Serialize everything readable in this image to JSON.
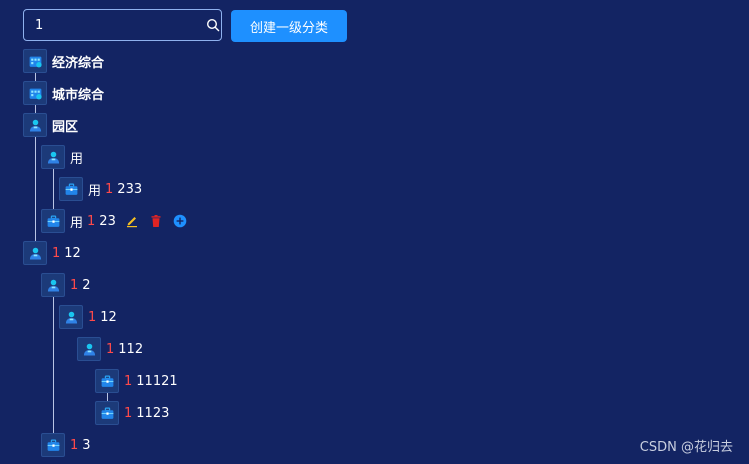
{
  "search": {
    "value": "1",
    "icon": "search-icon"
  },
  "toolbar": {
    "create_label": "创建一级分类"
  },
  "colors": {
    "background": "#132463",
    "highlight": "#ff4a4a",
    "primary": "#1e90ff",
    "edit": "#f5c022",
    "delete": "#e02424"
  },
  "tree": [
    {
      "id": "n0",
      "match": "",
      "rest": "经济综合",
      "icon": "department-icon",
      "depth": 0,
      "bold": true
    },
    {
      "id": "n1",
      "match": "",
      "rest": "城市综合",
      "icon": "department-icon",
      "depth": 0,
      "bold": true
    },
    {
      "id": "n2",
      "match": "",
      "rest": "园区",
      "icon": "person-icon",
      "depth": 0,
      "bold": true
    },
    {
      "id": "n3",
      "match": "",
      "rest": "用",
      "icon": "person-icon",
      "depth": 1
    },
    {
      "id": "n4",
      "pre": "用",
      "match": "1",
      "rest": "233",
      "icon": "briefcase-icon",
      "depth": 2
    },
    {
      "id": "n5",
      "pre": "用",
      "match": "1",
      "rest": "23",
      "icon": "briefcase-icon",
      "depth": 1,
      "actions": true
    },
    {
      "id": "n6",
      "match": "1",
      "rest": "12",
      "icon": "person-icon",
      "depth": 0
    },
    {
      "id": "n7",
      "match": "1",
      "rest": "2",
      "icon": "person-icon",
      "depth": 1
    },
    {
      "id": "n8",
      "match": "1",
      "rest": "12",
      "icon": "person-icon",
      "depth": 2
    },
    {
      "id": "n9",
      "match": "1",
      "rest": "112",
      "icon": "person-icon",
      "depth": 3
    },
    {
      "id": "n10",
      "match": "1",
      "rest": "11121",
      "icon": "briefcase-icon",
      "depth": 4
    },
    {
      "id": "n11",
      "match": "1",
      "rest": "1123",
      "icon": "briefcase-icon",
      "depth": 4
    },
    {
      "id": "n12",
      "match": "1",
      "rest": "3",
      "icon": "briefcase-icon",
      "depth": 1
    }
  ],
  "node_actions": [
    {
      "name": "edit-icon"
    },
    {
      "name": "delete-icon"
    },
    {
      "name": "add-icon"
    }
  ],
  "watermark": "CSDN @花归去"
}
